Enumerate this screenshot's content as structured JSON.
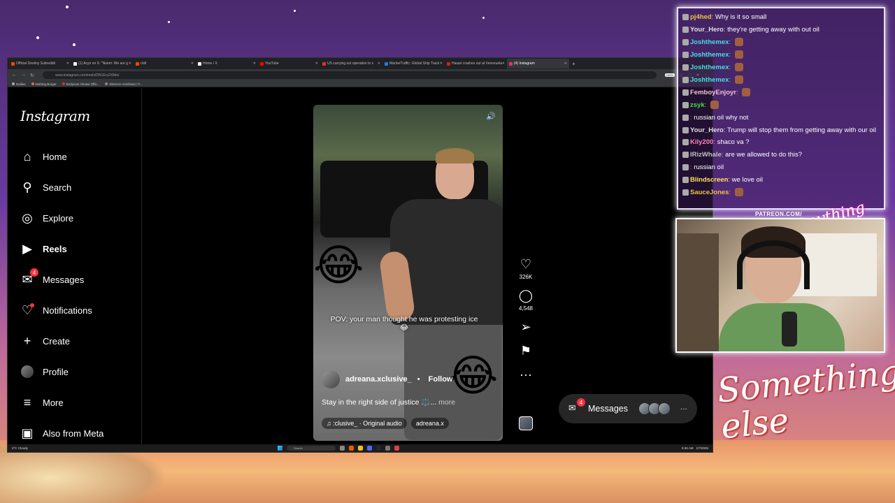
{
  "browser": {
    "tabs": [
      {
        "title": "Official Destiny Subreddit",
        "favicon_color": "#ff4500",
        "active": false
      },
      {
        "title": "(1) Acyn on X: \"Noem: We are g",
        "favicon_color": "#ffffff",
        "active": false
      },
      {
        "title": "r/all",
        "favicon_color": "#ff4500",
        "active": false
      },
      {
        "title": "Home / X",
        "favicon_color": "#ffffff",
        "active": false
      },
      {
        "title": "YouTube",
        "favicon_color": "#ff0000",
        "active": false
      },
      {
        "title": "US carrying out operation to s",
        "favicon_color": "#e03030",
        "active": false
      },
      {
        "title": "MarineTraffic: Global Ship Track",
        "favicon_color": "#2a7ad0",
        "active": false
      },
      {
        "title": "Hasan crashes out at Venezuela",
        "favicon_color": "#cc2222",
        "active": false
      },
      {
        "title": "(4) Instagram",
        "favicon_color": "#e1306c",
        "active": true
      }
    ],
    "new_tab": "+",
    "url": "www.instagram.com/reels/DN1Ery2X8do/",
    "zoom": "200%",
    "bookmarks": [
      "Dailies",
      "Nothing Burger",
      "Bodycam Shows Offic...",
      "Electron Anticheat | Tr..."
    ]
  },
  "instagram": {
    "logo": "Instagram",
    "nav": [
      {
        "label": "Home",
        "icon": "home-icon",
        "glyph": "⌂"
      },
      {
        "label": "Search",
        "icon": "search-icon",
        "glyph": "⚲"
      },
      {
        "label": "Explore",
        "icon": "compass-icon",
        "glyph": "◎"
      },
      {
        "label": "Reels",
        "icon": "reels-icon",
        "glyph": "▶"
      },
      {
        "label": "Messages",
        "icon": "messenger-icon",
        "glyph": "✉",
        "badge": "4"
      },
      {
        "label": "Notifications",
        "icon": "heart-icon",
        "glyph": "♡"
      },
      {
        "label": "Create",
        "icon": "plus-icon",
        "glyph": "+"
      },
      {
        "label": "Profile",
        "icon": "profile-avatar",
        "glyph": ""
      },
      {
        "label": "More",
        "icon": "menu-icon",
        "glyph": "≡"
      },
      {
        "label": "Also from Meta",
        "icon": "meta-icon",
        "glyph": "▣"
      }
    ],
    "reel": {
      "caption_overlay": "POV: your man thought he was protesting ice 😂",
      "username": "adreana.xclusive_",
      "separator": "•",
      "follow": "Follow",
      "description": "Stay in the right side of justice ⚖️...",
      "more": "more",
      "audio_label": "♫ :clusive_ · Original audio",
      "audio_user": "adreana.x",
      "emoji": "😂"
    },
    "actions": {
      "likes": "326K",
      "comments": "4,548"
    },
    "messages_pill": {
      "label": "Messages",
      "badge": "4",
      "dots": "···"
    }
  },
  "taskbar": {
    "weather_temp": "2°C",
    "weather_desc": "Cloudy",
    "search": "Search",
    "time": "8:45 AM",
    "date": "1/7/2026"
  },
  "chat": {
    "messages": [
      {
        "user": "pj4hed",
        "color": "#f0c040",
        "text": "Why is it so small"
      },
      {
        "user": "Your_Hero",
        "color": "#e0e0e0",
        "text": "they're getting away with out oil"
      },
      {
        "user": "Joshthemex",
        "color": "#40e0e0",
        "text": ""
      },
      {
        "user": "Joshthemex",
        "color": "#40e0e0",
        "text": ""
      },
      {
        "user": "Joshthemex",
        "color": "#40e0e0",
        "text": ""
      },
      {
        "user": "Joshthemex",
        "color": "#40e0e0",
        "text": ""
      },
      {
        "user": "FemboyEnjoyr",
        "color": "#f0c0d0",
        "text": ""
      },
      {
        "user": "zsyk",
        "color": "#40e040",
        "text": ""
      },
      {
        "user": "",
        "color": "#e04040",
        "text": "russian oil why not"
      },
      {
        "user": "Your_Hero",
        "color": "#e0e0e0",
        "text": "Trump will stop them from getting away with our oil"
      },
      {
        "user": "Kily200",
        "color": "#ff80c0",
        "text": "shaco va ?"
      },
      {
        "user": "IRizWhale",
        "color": "#c0c0c0",
        "text": "are we allowed to do this?"
      },
      {
        "user": "",
        "color": "#e04040",
        "text": "russian oil"
      },
      {
        "user": "Blindscreen",
        "color": "#ffe060",
        "text": "we love oil"
      },
      {
        "user": "SauceJones",
        "color": "#f0c040",
        "text": ""
      }
    ]
  },
  "overlay": {
    "patreon": "PATREON.COM/",
    "brand_small": "Anything else?",
    "brand_big": "Something else"
  }
}
